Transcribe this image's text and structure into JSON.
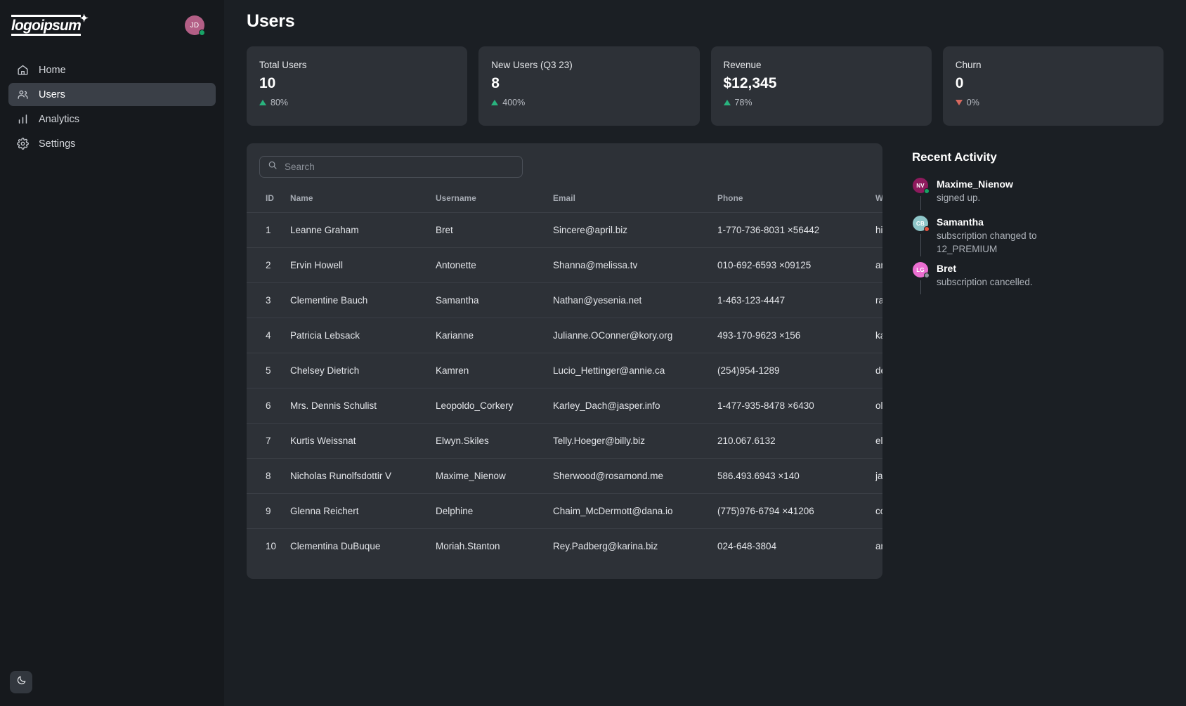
{
  "brand": {
    "logo_text": "logoipsum",
    "logo_star": "✦"
  },
  "user": {
    "initials": "JD",
    "status_color": "#18a366",
    "avatar_color": "#b35f86"
  },
  "sidebar": {
    "items": [
      {
        "label": "Home",
        "icon": "home-icon",
        "active": false
      },
      {
        "label": "Users",
        "icon": "users-icon",
        "active": true
      },
      {
        "label": "Analytics",
        "icon": "bar-chart-icon",
        "active": false
      },
      {
        "label": "Settings",
        "icon": "gear-icon",
        "active": false
      }
    ],
    "theme_toggle_icon": "moon-icon"
  },
  "header": {
    "title": "Users"
  },
  "stats": [
    {
      "label": "Total Users",
      "value": "10",
      "delta": "80%",
      "direction": "up"
    },
    {
      "label": "New Users (Q3 23)",
      "value": "8",
      "delta": "400%",
      "direction": "up"
    },
    {
      "label": "Revenue",
      "value": "$12,345",
      "delta": "78%",
      "direction": "up"
    },
    {
      "label": "Churn",
      "value": "0",
      "delta": "0%",
      "direction": "down"
    }
  ],
  "search": {
    "placeholder": "Search",
    "value": "",
    "icon": "search-icon"
  },
  "table": {
    "columns": [
      "ID",
      "Name",
      "Username",
      "Email",
      "Phone",
      "Website"
    ],
    "rows": [
      {
        "id": "1",
        "name": "Leanne Graham",
        "username": "Bret",
        "email": "Sincere@april.biz",
        "phone": "1-770-736-8031 ×56442",
        "website": "hildegard.org"
      },
      {
        "id": "2",
        "name": "Ervin Howell",
        "username": "Antonette",
        "email": "Shanna@melissa.tv",
        "phone": "010-692-6593 ×09125",
        "website": "anastasia.net"
      },
      {
        "id": "3",
        "name": "Clementine Bauch",
        "username": "Samantha",
        "email": "Nathan@yesenia.net",
        "phone": "1-463-123-4447",
        "website": "ramiro.info"
      },
      {
        "id": "4",
        "name": "Patricia Lebsack",
        "username": "Karianne",
        "email": "Julianne.OConner@kory.org",
        "phone": "493-170-9623 ×156",
        "website": "kale.biz"
      },
      {
        "id": "5",
        "name": "Chelsey Dietrich",
        "username": "Kamren",
        "email": "Lucio_Hettinger@annie.ca",
        "phone": "(254)954-1289",
        "website": "demarco.info"
      },
      {
        "id": "6",
        "name": "Mrs. Dennis Schulist",
        "username": "Leopoldo_Corkery",
        "email": "Karley_Dach@jasper.info",
        "phone": "1-477-935-8478 ×6430",
        "website": "ola.org"
      },
      {
        "id": "7",
        "name": "Kurtis Weissnat",
        "username": "Elwyn.Skiles",
        "email": "Telly.Hoeger@billy.biz",
        "phone": "210.067.6132",
        "website": "elvis.io"
      },
      {
        "id": "8",
        "name": "Nicholas Runolfsdottir V",
        "username": "Maxime_Nienow",
        "email": "Sherwood@rosamond.me",
        "phone": "586.493.6943 ×140",
        "website": "jacynthe.com"
      },
      {
        "id": "9",
        "name": "Glenna Reichert",
        "username": "Delphine",
        "email": "Chaim_McDermott@dana.io",
        "phone": "(775)976-6794 ×41206",
        "website": "conrad.com"
      },
      {
        "id": "10",
        "name": "Clementina DuBuque",
        "username": "Moriah.Stanton",
        "email": "Rey.Padberg@karina.biz",
        "phone": "024-648-3804",
        "website": "ambrose.net"
      }
    ]
  },
  "activity": {
    "title": "Recent Activity",
    "items": [
      {
        "initials": "NV",
        "name": "Maxime_Nienow",
        "text": "signed up.",
        "avatar_color": "#8e1a5d",
        "dot_color": "#17a364"
      },
      {
        "initials": "CB",
        "name": "Samantha",
        "text": "subscription changed to 12_PREMIUM",
        "avatar_color": "#8ec6c9",
        "dot_color": "#e2533f"
      },
      {
        "initials": "LG",
        "name": "Bret",
        "text": "subscription cancelled.",
        "avatar_color": "#eb6ed1",
        "dot_color": "#8f949b"
      }
    ]
  }
}
